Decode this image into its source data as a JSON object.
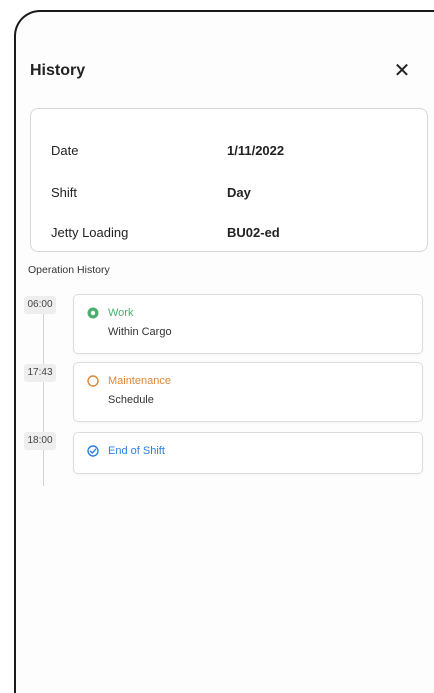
{
  "header": {
    "title": "History",
    "close_label": "✕"
  },
  "info": {
    "date_label": "Date",
    "date_value": "1/11/2022",
    "shift_label": "Shift",
    "shift_value": "Day",
    "jetty_label": "Jetty Loading",
    "jetty_value": "BU02-ed"
  },
  "operation_history": {
    "title": "Operation History",
    "events": [
      {
        "time": "06:00",
        "title": "Work",
        "subtitle": "Within Cargo",
        "color": "#4caf6e",
        "icon": "filled-circle-icon"
      },
      {
        "time": "17:43",
        "title": "Maintenance",
        "subtitle": "Schedule",
        "color": "#e0883a",
        "icon": "hollow-circle-icon"
      },
      {
        "time": "18:00",
        "title": "End of Shift",
        "subtitle": "",
        "color": "#2f7fe0",
        "icon": "check-circle-icon"
      }
    ]
  }
}
